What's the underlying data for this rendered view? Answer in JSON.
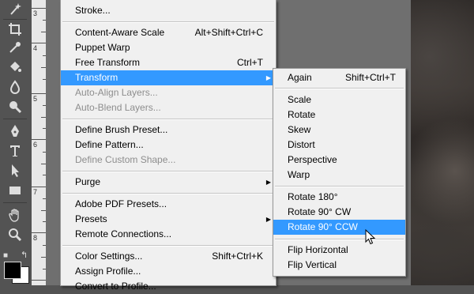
{
  "ruler": {
    "labels": [
      "3",
      "4",
      "5",
      "6",
      "7",
      "8"
    ]
  },
  "main_menu": {
    "items": [
      {
        "label": "Stroke...",
        "shortcut": "",
        "disabled": false
      },
      {
        "label": "Content-Aware Scale",
        "shortcut": "Alt+Shift+Ctrl+C",
        "disabled": false
      },
      {
        "label": "Puppet Warp",
        "shortcut": "",
        "disabled": false
      },
      {
        "label": "Free Transform",
        "shortcut": "Ctrl+T",
        "disabled": false
      },
      {
        "label": "Transform",
        "shortcut": "",
        "disabled": false,
        "submenu": true
      },
      {
        "label": "Auto-Align Layers...",
        "shortcut": "",
        "disabled": true
      },
      {
        "label": "Auto-Blend Layers...",
        "shortcut": "",
        "disabled": true
      },
      {
        "label": "Define Brush Preset...",
        "shortcut": "",
        "disabled": false
      },
      {
        "label": "Define Pattern...",
        "shortcut": "",
        "disabled": false
      },
      {
        "label": "Define Custom Shape...",
        "shortcut": "",
        "disabled": true
      },
      {
        "label": "Purge",
        "shortcut": "",
        "disabled": false,
        "submenu": true
      },
      {
        "label": "Adobe PDF Presets...",
        "shortcut": "",
        "disabled": false
      },
      {
        "label": "Presets",
        "shortcut": "",
        "disabled": false,
        "submenu": true
      },
      {
        "label": "Remote Connections...",
        "shortcut": "",
        "disabled": false
      },
      {
        "label": "Color Settings...",
        "shortcut": "Shift+Ctrl+K",
        "disabled": false
      },
      {
        "label": "Assign Profile...",
        "shortcut": "",
        "disabled": false
      },
      {
        "label": "Convert to Profile...",
        "shortcut": "",
        "disabled": false
      }
    ]
  },
  "transform_menu": {
    "items": [
      {
        "label": "Again",
        "shortcut": "Shift+Ctrl+T"
      },
      {
        "label": "Scale",
        "shortcut": ""
      },
      {
        "label": "Rotate",
        "shortcut": ""
      },
      {
        "label": "Skew",
        "shortcut": ""
      },
      {
        "label": "Distort",
        "shortcut": ""
      },
      {
        "label": "Perspective",
        "shortcut": ""
      },
      {
        "label": "Warp",
        "shortcut": ""
      },
      {
        "label": "Rotate 180°",
        "shortcut": ""
      },
      {
        "label": "Rotate 90° CW",
        "shortcut": ""
      },
      {
        "label": "Rotate 90° CCW",
        "shortcut": ""
      },
      {
        "label": "Flip Horizontal",
        "shortcut": ""
      },
      {
        "label": "Flip Vertical",
        "shortcut": ""
      }
    ]
  },
  "highlight_color": "#3399ff",
  "icons": [
    "wand-icon",
    "crop-icon",
    "eyedropper-icon",
    "healing-brush-icon",
    "brush-icon",
    "clone-stamp-icon",
    "history-brush-icon",
    "eraser-icon",
    "paint-bucket-icon",
    "blur-icon",
    "dodge-icon",
    "pen-icon",
    "type-icon",
    "path-selection-icon",
    "rectangle-shape-icon",
    "hand-icon",
    "zoom-icon"
  ]
}
